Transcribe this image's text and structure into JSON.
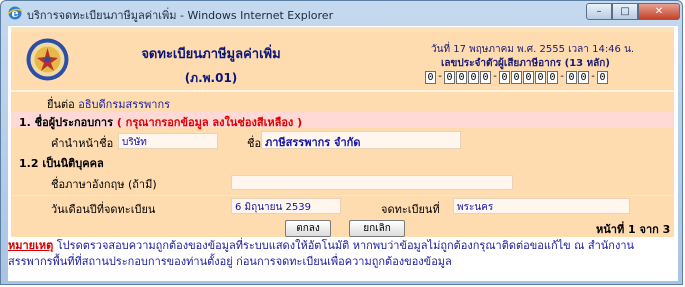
{
  "window": {
    "title": "บริการจดทะเบียนภาษีมูลค่าเพิ่ม - Windows Internet Explorer",
    "minimize": "–",
    "maximize": "□",
    "close": "✕"
  },
  "header": {
    "title": "จดทะเบียนภาษีมูลค่าเพิ่ม",
    "subtitle": "(ภ.พ.01)",
    "date": "วันที่ 17 พฤษภาคม พ.ศ. 2555  เวลา 14:46 น.",
    "taxid_label": "เลขประจำตัวผู้เสียภาษีอากร (13 หลัก)",
    "taxid": [
      "0",
      "0",
      "0",
      "0",
      "0",
      "0",
      "0",
      "0",
      "0",
      "0",
      "0",
      "0",
      "0"
    ]
  },
  "submit_to": {
    "prefix": "ยื่นต่อ",
    "to": "อธิบดีกรมสรรพากร"
  },
  "section1": {
    "title": "1.  ชื่อผู้ประกอบการ",
    "warning": "( กรุณากรอกข้อมูล ลงในช่องสีเหลือง )"
  },
  "form": {
    "prefix_label": "คำนำหน้าชื่อ",
    "prefix_value": "บริษัท",
    "name_label": "ชื่อ",
    "name_value": "ภาษีสรรพากร จำกัด",
    "section12": "1.2  เป็นนิติบุคคล",
    "eng_label": "ชื่อภาษาอังกฤษ (ถ้ามี)",
    "eng_value": "",
    "regdate_label": "วันเดือนปีที่จดทะเบียน",
    "regdate_value": "6 มิถุนายน 2539",
    "regat_label": "จดทะเบียนที่",
    "regat_value": "พระนคร"
  },
  "buttons": {
    "ok": "ตกลง",
    "cancel": "ยกเลิก"
  },
  "paging": "หน้าที่ 1 จาก 3",
  "note": {
    "label": "หมายเหตุ",
    "text": "   โปรดตรวจสอบความถูกต้องของข้อมูลที่ระบบแสดงให้อัตโนมัติ หากพบว่าข้อมูลไม่ถูกต้องกรุณาติดต่อขอแก้ไข ณ สำนักงานสรรพากรพื้นที่ที่สถานประกอบการของท่านตั้งอยู่ ก่อนการจดทะเบียนเพื่อความถูกต้องของข้อมูล"
  },
  "colors": {
    "panel": "#ffdcb0",
    "field": "#fff7ee",
    "warning": "#e00000",
    "link": "#1b1ca0"
  }
}
